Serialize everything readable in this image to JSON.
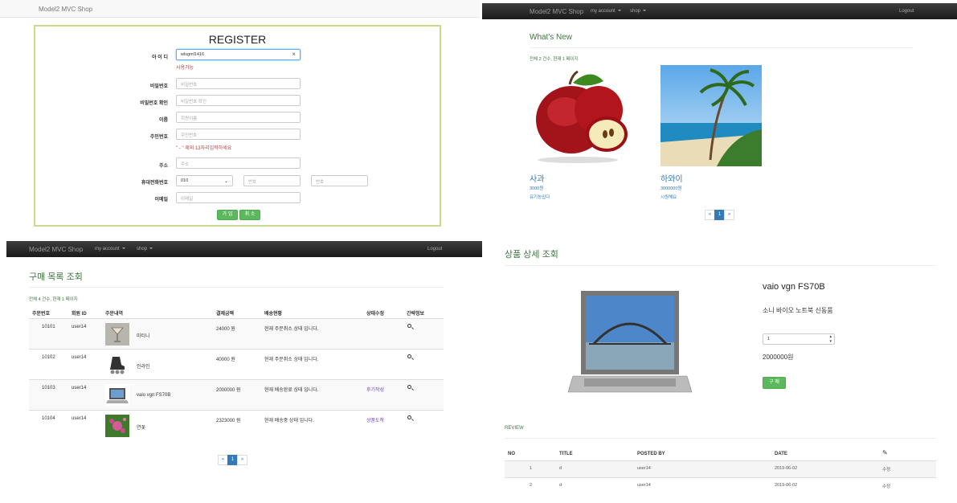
{
  "register": {
    "brand": "Model2 MVC Shop",
    "title": "REGISTER",
    "fields": {
      "id_label": "아 이 디",
      "id_value": "wlsgml1416",
      "id_clear": "×",
      "id_hint": "사용가능",
      "pw_label": "비밀번호",
      "pw_placeholder": "비밀번호",
      "pw2_label": "비밀번호 확인",
      "pw2_placeholder": "비밀번호 확인",
      "name_label": "이름",
      "name_placeholder": "회원이름",
      "ssn_label": "주민번호",
      "ssn_placeholder": "주민번호",
      "ssn_hint": "\" - \" 제외 13자리입력하세요",
      "addr_label": "주소",
      "addr_placeholder": "주소",
      "phone_label": "휴대전화번호",
      "phone_select": "010",
      "phone_mid_placeholder": "번호",
      "phone_last_placeholder": "번호",
      "email_label": "이메일",
      "email_placeholder": "이메일"
    },
    "buttons": {
      "join": "가 입",
      "cancel": "취 소"
    }
  },
  "whats_new": {
    "brand": "Model2 MVC Shop",
    "nav": {
      "account": "my account",
      "shop": "shop",
      "logout": "Logout"
    },
    "title": "What's New",
    "count": "전체 2 건수, 현재 1 페이지",
    "products": [
      {
        "name": "사과",
        "price": "3000원",
        "desc": "유기농입다"
      },
      {
        "name": "하와이",
        "price": "3000000원",
        "desc": "시원해요"
      }
    ],
    "pager": {
      "prev": "«",
      "current": "1",
      "next": "»"
    }
  },
  "orders": {
    "brand": "Model2 MVC Shop",
    "nav": {
      "account": "my account",
      "shop": "shop",
      "logout": "Logout"
    },
    "title": "구매 목록 조회",
    "count": "전체 4 건수, 현재 1 페이지",
    "headers": [
      "주문번호",
      "회원 ID",
      "주문내역",
      "결제금액",
      "배송현황",
      "상태수정",
      "간략정보"
    ],
    "rows": [
      {
        "no": "10101",
        "user": "user14",
        "item": "마티니",
        "amount": "24000 원",
        "status": "현재 주문취소 상태 입니다.",
        "action": ""
      },
      {
        "no": "10102",
        "user": "user14",
        "item": "인라인",
        "amount": "40000 원",
        "status": "현재 주문취소 상태 입니다.",
        "action": ""
      },
      {
        "no": "10103",
        "user": "user14",
        "item": "vaio vgn FS70B",
        "amount": "2000000 원",
        "status": "현재 배송완료 상태 입니다.",
        "action": "후기작성"
      },
      {
        "no": "10104",
        "user": "user14",
        "item": "연꽃",
        "amount": "2323000 원",
        "status": "현재 배송중 상태 입니다.",
        "action": "상품도착"
      }
    ],
    "pager": {
      "prev": "«",
      "current": "1",
      "next": "»"
    }
  },
  "detail": {
    "title": "상품 상세 조회",
    "product_name": "vaio vgn FS70B",
    "product_desc": "소니 바이오 노트북 신동품",
    "quantity": "1",
    "price": "2000000원",
    "buy_button": "구 매",
    "review_title": "REVIEW",
    "review_headers": [
      "NO",
      "TITLE",
      "POSTED BY",
      "DATE"
    ],
    "reviews": [
      {
        "no": "1",
        "title": "d",
        "by": "user14",
        "date": "2019-06-02",
        "action": "수정"
      },
      {
        "no": "2",
        "title": "d",
        "by": "user14",
        "date": "2019-06-02",
        "action": "수정"
      }
    ]
  }
}
